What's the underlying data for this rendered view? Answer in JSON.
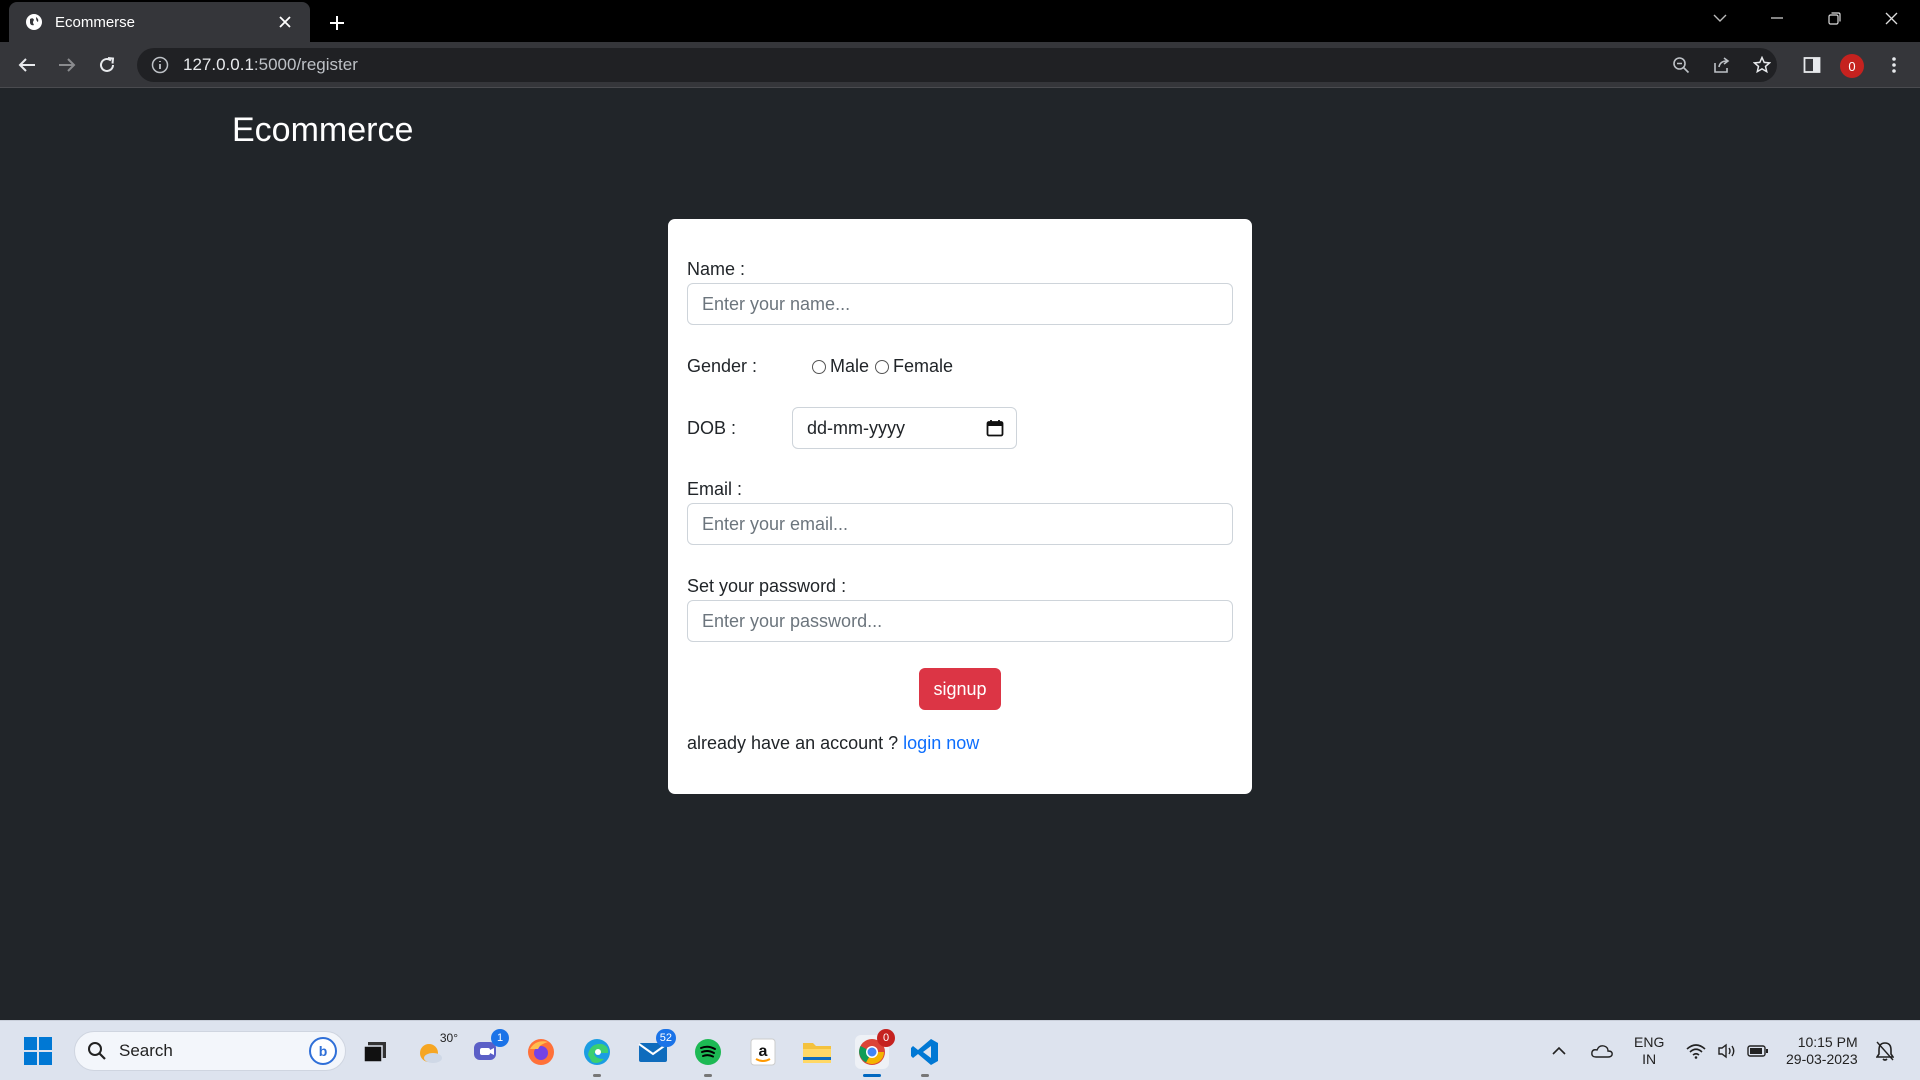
{
  "browser": {
    "tab_title": "Ecommerse",
    "url_host": "127.0.0.1",
    "url_rest": ":5000/register",
    "profile_badge": "0"
  },
  "page": {
    "brand": "Ecommerce",
    "form": {
      "name_label": "Name :",
      "name_placeholder": "Enter your name...",
      "gender_label": "Gender :",
      "gender_options": [
        "Male",
        "Female"
      ],
      "dob_label": "DOB :",
      "dob_placeholder": "dd-mm-yyyy",
      "email_label": "Email :",
      "email_placeholder": "Enter your email...",
      "password_label": "Set your password :",
      "password_placeholder": "Enter your password...",
      "signup_label": "signup",
      "footer_text": "already have an account ?",
      "login_link": "login now"
    }
  },
  "taskbar": {
    "search_label": "Search",
    "weather_temp": "30°",
    "teams_badge": "1",
    "mail_badge": "52",
    "chrome_badge": "0",
    "lang_top": "ENG",
    "lang_bottom": "IN",
    "time": "10:15 PM",
    "date": "29-03-2023"
  },
  "colors": {
    "page_bg": "#212529",
    "signup": "#dc3545",
    "link": "#0d6efd"
  }
}
